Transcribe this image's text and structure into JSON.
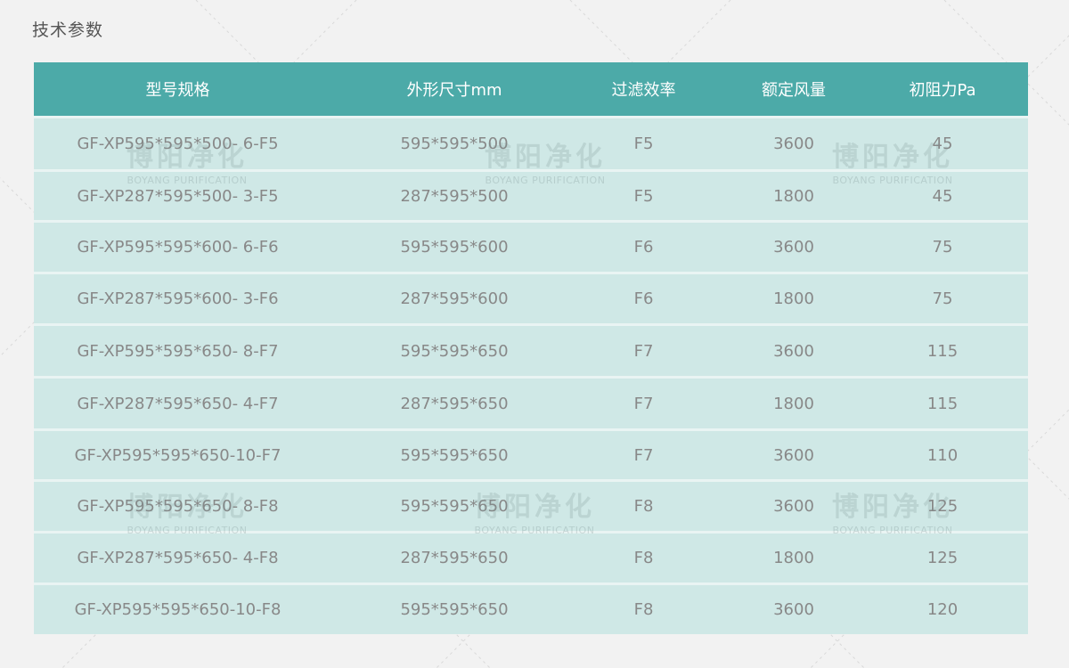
{
  "page": {
    "title": "技术参数"
  },
  "table": {
    "headers": [
      "型号规格",
      "外形尺寸mm",
      "过滤效率",
      "额定风量",
      "初阻力Pa"
    ],
    "rows": [
      [
        "GF-XP595*595*500- 6-F5",
        "595*595*500",
        "F5",
        "3600",
        "45"
      ],
      [
        "GF-XP287*595*500- 3-F5",
        "287*595*500",
        "F5",
        "1800",
        "45"
      ],
      [
        "GF-XP595*595*600- 6-F6",
        "595*595*600",
        "F6",
        "3600",
        "75"
      ],
      [
        "GF-XP287*595*600- 3-F6",
        "287*595*600",
        "F6",
        "1800",
        "75"
      ],
      [
        "GF-XP595*595*650- 8-F7",
        "595*595*650",
        "F7",
        "3600",
        "115"
      ],
      [
        "GF-XP287*595*650- 4-F7",
        "287*595*650",
        "F7",
        "1800",
        "115"
      ],
      [
        "GF-XP595*595*650-10-F7",
        "595*595*650",
        "F7",
        "3600",
        "110"
      ],
      [
        "GF-XP595*595*650- 8-F8",
        "595*595*650",
        "F8",
        "3600",
        "125"
      ],
      [
        "GF-XP287*595*650- 4-F8",
        "287*595*650",
        "F8",
        "1800",
        "125"
      ],
      [
        "GF-XP595*595*650-10-F8",
        "595*595*650",
        "F8",
        "3600",
        "120"
      ]
    ]
  },
  "watermark": {
    "cn": "博阳净化",
    "en": "BOYANG PURIFICATION"
  },
  "colors": {
    "header_bg": "#4caaa8",
    "row_bg": "#cfe8e6",
    "page_bg": "#f2f2f2"
  }
}
